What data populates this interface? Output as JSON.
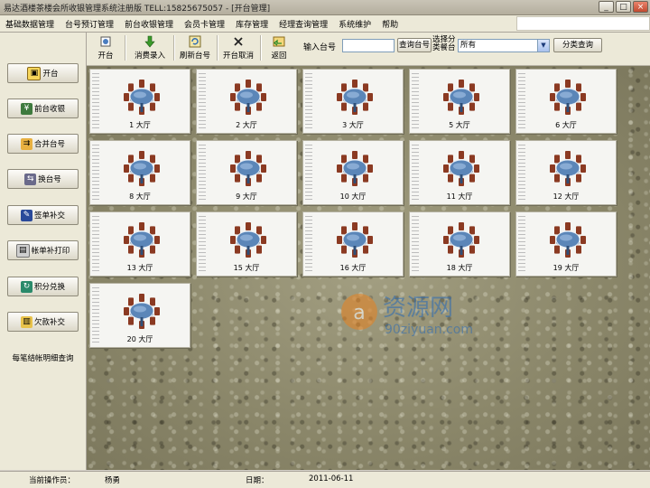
{
  "window": {
    "title": "易达酒楼茶楼会所收银管理系统注册版 TELL:15825675057 - [开台管理]",
    "buttons": [
      "_",
      "□",
      "×"
    ]
  },
  "menu": [
    "基础数据管理",
    "台号预订管理",
    "前台收银管理",
    "会员卡管理",
    "库存管理",
    "经理查询管理",
    "系统维护",
    "帮助"
  ],
  "toolbar": {
    "buttons": [
      {
        "label": "开台",
        "icon": "open-table-icon"
      },
      {
        "label": "消费录入",
        "icon": "download-arrow-icon"
      },
      {
        "label": "刷新台号",
        "icon": "refresh-icon"
      },
      {
        "label": "开台取消",
        "icon": "cancel-x-icon"
      },
      {
        "label": "返回",
        "icon": "return-icon"
      }
    ],
    "table_input_label": "输入台号",
    "table_input_value": "",
    "search_button": "查询台号",
    "category_label": "选择分类餐台",
    "category_value": "所有",
    "category_search_button": "分类查询"
  },
  "sidebar": [
    {
      "label": "开台",
      "icon": "open-icon"
    },
    {
      "label": "前台收银",
      "icon": "cashier-icon"
    },
    {
      "label": "合并台号",
      "icon": "merge-icon"
    },
    {
      "label": "换台号",
      "icon": "swap-icon"
    },
    {
      "label": "签单补交",
      "icon": "sign-icon"
    },
    {
      "label": "帐单补打印",
      "icon": "printer-icon"
    },
    {
      "label": "积分兑换",
      "icon": "points-icon"
    },
    {
      "label": "欠款补交",
      "icon": "debt-icon"
    },
    {
      "label": "每笔结帐明细查询",
      "icon": ""
    }
  ],
  "tables": [
    {
      "label": "1 大厅"
    },
    {
      "label": "2 大厅"
    },
    {
      "label": "3 大厅"
    },
    {
      "label": "5 大厅"
    },
    {
      "label": "6 大厅"
    },
    {
      "label": "8 大厅"
    },
    {
      "label": "9 大厅"
    },
    {
      "label": "10 大厅"
    },
    {
      "label": "11 大厅"
    },
    {
      "label": "12 大厅"
    },
    {
      "label": "13 大厅"
    },
    {
      "label": "15 大厅"
    },
    {
      "label": "16 大厅"
    },
    {
      "label": "18 大厅"
    },
    {
      "label": "19 大厅"
    },
    {
      "label": "20 大厅"
    }
  ],
  "watermark": {
    "line1": "资源网",
    "line2": "90ziyuan.com"
  },
  "status": {
    "operator_label": "当前操作员：",
    "operator_value": "杨勇",
    "date_label": "日期：",
    "date_value": "2011-06-11"
  },
  "colors": {
    "table_top": "#5b86b8",
    "chair": "#8b3a22",
    "accent": "#e8821f"
  }
}
